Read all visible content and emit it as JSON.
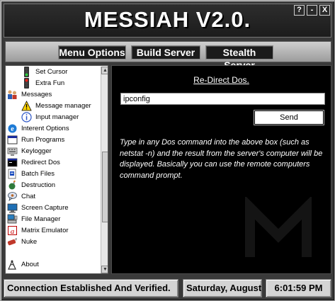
{
  "app": {
    "title": "MESSIAH V2.0."
  },
  "window_controls": {
    "help": "?",
    "minimize": "-",
    "close": "X"
  },
  "menu": {
    "items": [
      {
        "label": "Menu Options"
      },
      {
        "label": "Build Server"
      },
      {
        "label": "Stealth Server"
      }
    ]
  },
  "sidebar": {
    "items": [
      {
        "label": "Set Cursor",
        "icon": "traffic-light-icon"
      },
      {
        "label": "Extra Fun",
        "icon": "traffic-light-icon"
      },
      {
        "label": "Messages",
        "icon": "people-icon"
      },
      {
        "label": "Message manager",
        "icon": "warning-icon"
      },
      {
        "label": "Input manager",
        "icon": "info-icon"
      },
      {
        "label": "Interent Options",
        "icon": "internet-explorer-icon"
      },
      {
        "label": "Run Programs",
        "icon": "window-icon"
      },
      {
        "label": "Keylogger",
        "icon": "keyboard-icon"
      },
      {
        "label": "Redirect Dos",
        "icon": "dos-icon"
      },
      {
        "label": "Batch Files",
        "icon": "batch-file-icon"
      },
      {
        "label": "Destruction",
        "icon": "bomb-icon"
      },
      {
        "label": "Chat",
        "icon": "chat-icon"
      },
      {
        "label": "Screen Capture",
        "icon": "monitor-icon"
      },
      {
        "label": "File Manager",
        "icon": "computer-icon"
      },
      {
        "label": "Matrix Emulator",
        "icon": "matrix-icon"
      },
      {
        "label": "Nuke",
        "icon": "nuke-icon"
      },
      {
        "label": "About",
        "icon": "about-icon"
      }
    ]
  },
  "main": {
    "title": "Re-Direct Dos.",
    "command_value": "ipconfig",
    "send_label": "Send",
    "help_text": "Type in any Dos command into the above box (such as netstat -n) and the result from the server's computer will be displayed. Basically you can use the remote computers command prompt."
  },
  "status": {
    "connection": "Connection Established And Verified.",
    "date": "Saturday, August",
    "time": "6:01:59 PM"
  },
  "colors": {
    "background": "#000000",
    "panel": "#3a3a3a",
    "accent": "#ffffff"
  }
}
